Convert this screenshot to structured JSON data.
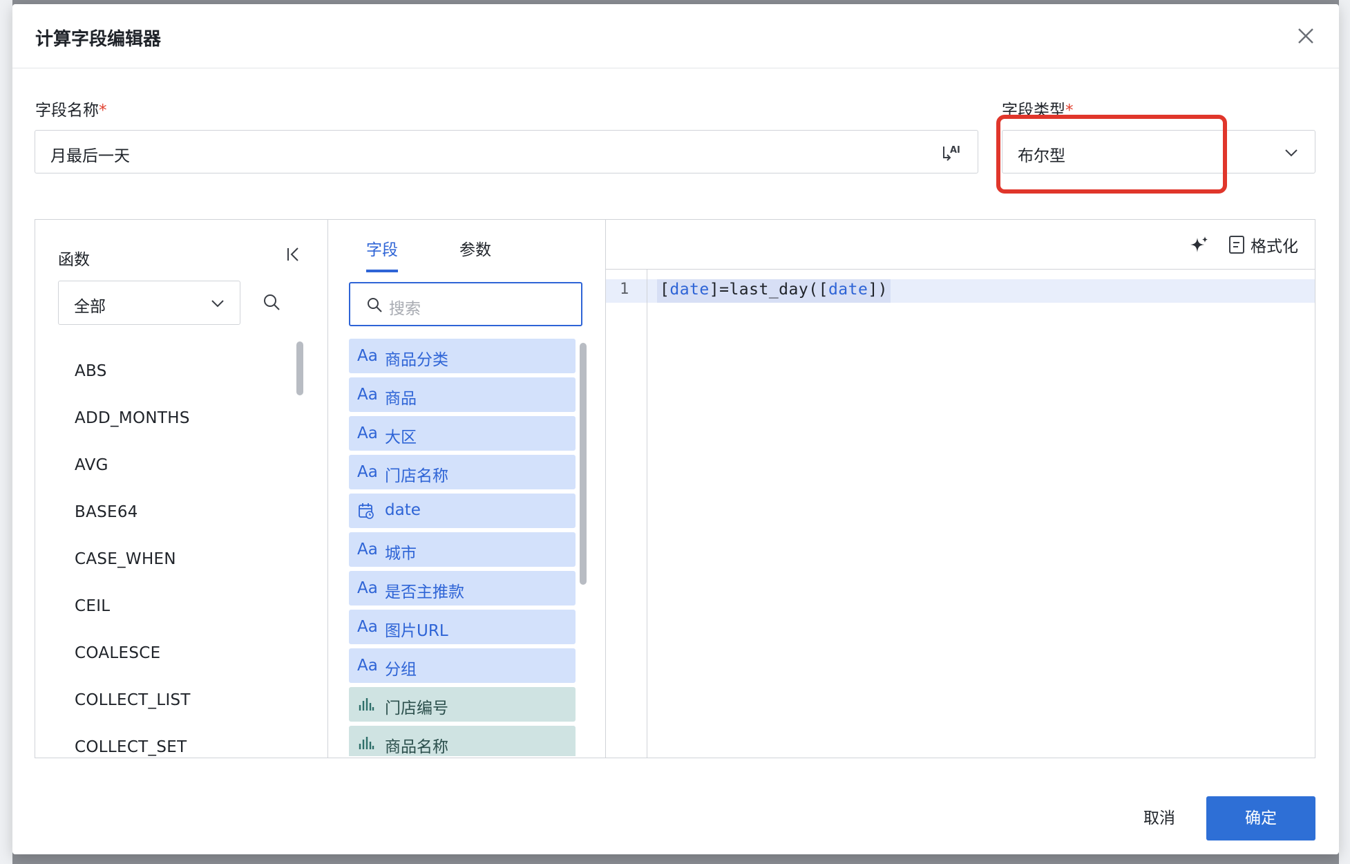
{
  "dialog": {
    "title": "计算字段编辑器",
    "field_name_label": "字段名称",
    "field_type_label": "字段类型",
    "required_mark": "*",
    "field_name_value": "月最后一天",
    "field_type_value": "布尔型",
    "cancel_label": "取消",
    "ok_label": "确定"
  },
  "functions": {
    "title": "函数",
    "category_value": "全部",
    "items": [
      "ABS",
      "ADD_MONTHS",
      "AVG",
      "BASE64",
      "CASE_WHEN",
      "CEIL",
      "COALESCE",
      "COLLECT_LIST",
      "COLLECT_SET"
    ]
  },
  "fields_panel": {
    "tabs": [
      "字段",
      "参数"
    ],
    "active_tab": "字段",
    "search_placeholder": "搜索",
    "items": [
      {
        "icon": "Aa",
        "name": "商品分类",
        "kind": "dimension"
      },
      {
        "icon": "Aa",
        "name": "商品",
        "kind": "dimension"
      },
      {
        "icon": "Aa",
        "name": "大区",
        "kind": "dimension"
      },
      {
        "icon": "Aa",
        "name": "门店名称",
        "kind": "dimension"
      },
      {
        "icon": "date-icon",
        "name": "date",
        "kind": "dimension"
      },
      {
        "icon": "Aa",
        "name": "城市",
        "kind": "dimension"
      },
      {
        "icon": "Aa",
        "name": "是否主推款",
        "kind": "dimension"
      },
      {
        "icon": "Aa",
        "name": "图片URL",
        "kind": "dimension"
      },
      {
        "icon": "Aa",
        "name": "分组",
        "kind": "dimension"
      },
      {
        "icon": "bar-chart-icon",
        "name": "门店编号",
        "kind": "measure"
      },
      {
        "icon": "bar-chart-icon",
        "name": "商品名称",
        "kind": "measure"
      }
    ]
  },
  "code_editor": {
    "format_label": "格式化",
    "lines": [
      {
        "no": "1",
        "parts": [
          {
            "t": "[",
            "c": ""
          },
          {
            "t": "date",
            "c": "field"
          },
          {
            "t": "]=last_day(",
            "c": ""
          },
          {
            "t": "[",
            "c": ""
          },
          {
            "t": "date",
            "c": "field"
          },
          {
            "t": "])",
            "c": ""
          }
        ]
      }
    ]
  },
  "colors": {
    "accent": "#2e64d6",
    "highlight_box": "#e0362b",
    "dimension_bg": "#d3e1fb",
    "measure_bg": "#cfe3e2"
  }
}
